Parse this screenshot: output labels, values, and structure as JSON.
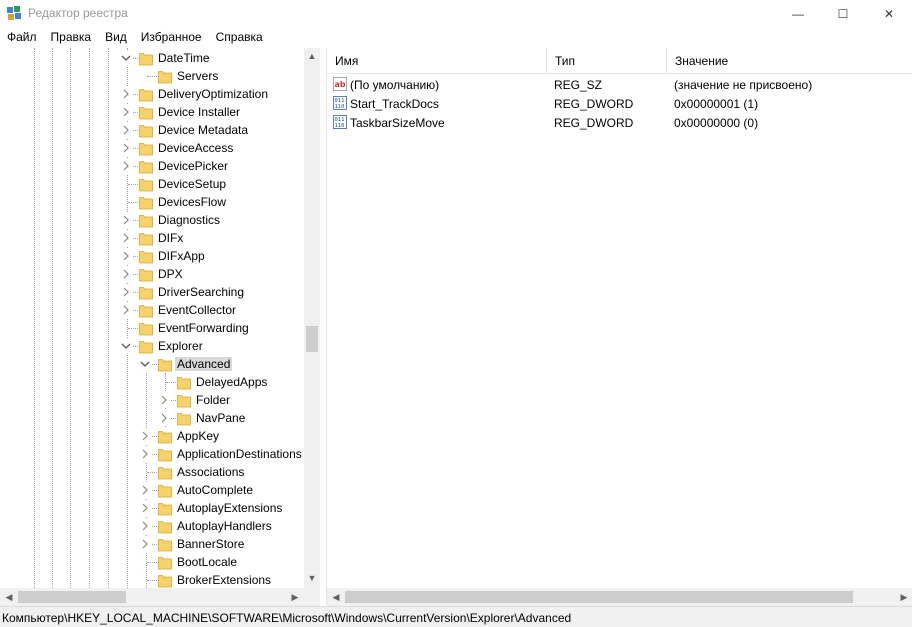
{
  "window": {
    "title": "Редактор реестра",
    "minimize_glyph": "—",
    "maximize_glyph": "☐",
    "close_glyph": "✕"
  },
  "menu": [
    "Файл",
    "Правка",
    "Вид",
    "Избранное",
    "Справка"
  ],
  "tree": {
    "items": [
      {
        "label": "DateTime",
        "depth": 0,
        "expander": "open",
        "selected": false
      },
      {
        "label": "Servers",
        "depth": 1,
        "expander": "none",
        "selected": false
      },
      {
        "label": "DeliveryOptimization",
        "depth": 0,
        "expander": "closed",
        "selected": false
      },
      {
        "label": "Device Installer",
        "depth": 0,
        "expander": "closed",
        "selected": false
      },
      {
        "label": "Device Metadata",
        "depth": 0,
        "expander": "closed",
        "selected": false
      },
      {
        "label": "DeviceAccess",
        "depth": 0,
        "expander": "closed",
        "selected": false
      },
      {
        "label": "DevicePicker",
        "depth": 0,
        "expander": "closed",
        "selected": false
      },
      {
        "label": "DeviceSetup",
        "depth": 0,
        "expander": "none",
        "selected": false
      },
      {
        "label": "DevicesFlow",
        "depth": 0,
        "expander": "none",
        "selected": false
      },
      {
        "label": "Diagnostics",
        "depth": 0,
        "expander": "closed",
        "selected": false
      },
      {
        "label": "DIFx",
        "depth": 0,
        "expander": "closed",
        "selected": false
      },
      {
        "label": "DIFxApp",
        "depth": 0,
        "expander": "closed",
        "selected": false
      },
      {
        "label": "DPX",
        "depth": 0,
        "expander": "closed",
        "selected": false
      },
      {
        "label": "DriverSearching",
        "depth": 0,
        "expander": "closed",
        "selected": false
      },
      {
        "label": "EventCollector",
        "depth": 0,
        "expander": "closed",
        "selected": false
      },
      {
        "label": "EventForwarding",
        "depth": 0,
        "expander": "none",
        "selected": false
      },
      {
        "label": "Explorer",
        "depth": 0,
        "expander": "open",
        "selected": false
      },
      {
        "label": "Advanced",
        "depth": 1,
        "expander": "open",
        "selected": true
      },
      {
        "label": "DelayedApps",
        "depth": 2,
        "expander": "none",
        "selected": false
      },
      {
        "label": "Folder",
        "depth": 2,
        "expander": "closed",
        "selected": false
      },
      {
        "label": "NavPane",
        "depth": 2,
        "expander": "closed",
        "selected": false
      },
      {
        "label": "AppKey",
        "depth": 1,
        "expander": "closed",
        "selected": false
      },
      {
        "label": "ApplicationDestinations",
        "depth": 1,
        "expander": "closed",
        "selected": false
      },
      {
        "label": "Associations",
        "depth": 1,
        "expander": "none",
        "selected": false
      },
      {
        "label": "AutoComplete",
        "depth": 1,
        "expander": "closed",
        "selected": false
      },
      {
        "label": "AutoplayExtensions",
        "depth": 1,
        "expander": "closed",
        "selected": false
      },
      {
        "label": "AutoplayHandlers",
        "depth": 1,
        "expander": "closed",
        "selected": false
      },
      {
        "label": "BannerStore",
        "depth": 1,
        "expander": "closed",
        "selected": false
      },
      {
        "label": "BootLocale",
        "depth": 1,
        "expander": "none",
        "selected": false
      },
      {
        "label": "BrokerExtensions",
        "depth": 1,
        "expander": "none",
        "selected": false
      }
    ]
  },
  "list": {
    "columns": [
      "Имя",
      "Тип",
      "Значение"
    ],
    "rows": [
      {
        "icon": "string-value-icon",
        "name": "(По умолчанию)",
        "type": "REG_SZ",
        "value": "(значение не присвоено)"
      },
      {
        "icon": "binary-value-icon",
        "name": "Start_TrackDocs",
        "type": "REG_DWORD",
        "value": "0x00000001 (1)"
      },
      {
        "icon": "binary-value-icon",
        "name": "TaskbarSizeMove",
        "type": "REG_DWORD",
        "value": "0x00000000 (0)"
      }
    ]
  },
  "status": {
    "path": "Компьютер\\HKEY_LOCAL_MACHINE\\SOFTWARE\\Microsoft\\Windows\\CurrentVersion\\Explorer\\Advanced"
  },
  "colors": {
    "folder": "#f5d26b",
    "folder_edge": "#d9a92a",
    "selection": "#d9d9d9",
    "accent": "#1e6fd9"
  }
}
